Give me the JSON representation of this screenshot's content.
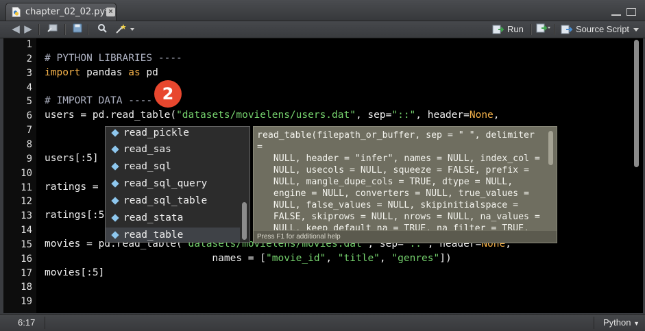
{
  "tab": {
    "label": "chapter_02_02.py*"
  },
  "toolbar": {
    "run_label": "Run",
    "source_label": "Source Script"
  },
  "badge": "2",
  "editor": {
    "line_numbers": [
      "1",
      "2",
      "3",
      "4",
      "5",
      "6",
      "7",
      "8",
      "9",
      "10",
      "11",
      "12",
      "13",
      "14",
      "15",
      "16",
      "17",
      "18",
      "19"
    ],
    "lines": [
      {
        "n": 2,
        "parts": [
          {
            "t": "# PYTHON LIBRARIES ----",
            "c": "cm"
          }
        ]
      },
      {
        "n": 3,
        "parts": [
          {
            "t": "import",
            "c": "kw"
          },
          {
            "t": " pandas ",
            "c": ""
          },
          {
            "t": "as",
            "c": "kw"
          },
          {
            "t": " pd",
            "c": ""
          }
        ]
      },
      {
        "n": 5,
        "parts": [
          {
            "t": "# IMPORT DATA ----",
            "c": "cm"
          }
        ]
      },
      {
        "n": 6,
        "parts": [
          {
            "t": "users = pd.read_table(",
            "c": ""
          },
          {
            "t": "\"datasets/movielens/users.dat\"",
            "c": "str"
          },
          {
            "t": ", sep=",
            "c": ""
          },
          {
            "t": "\"::\"",
            "c": "str"
          },
          {
            "t": ", header=",
            "c": ""
          },
          {
            "t": "None",
            "c": "kw"
          },
          {
            "t": ",",
            "c": ""
          }
        ]
      },
      {
        "n": 9,
        "parts": [
          {
            "t": "users[:5]",
            "c": ""
          }
        ]
      },
      {
        "n": 11,
        "parts": [
          {
            "t": "ratings =",
            "c": ""
          }
        ]
      },
      {
        "n": 13,
        "parts": [
          {
            "t": "ratings[:5",
            "c": ""
          }
        ]
      },
      {
        "n": 15,
        "parts": [
          {
            "t": "movies = pd.read_table(",
            "c": ""
          },
          {
            "t": "\"datasets/movielens/movies.dat\"",
            "c": "str"
          },
          {
            "t": ", sep=",
            "c": ""
          },
          {
            "t": "\"::\"",
            "c": "str"
          },
          {
            "t": ", header=",
            "c": ""
          },
          {
            "t": "None",
            "c": "kw"
          },
          {
            "t": ",",
            "c": ""
          }
        ]
      },
      {
        "n": 16,
        "parts": [
          {
            "t": "                            names = [",
            "c": ""
          },
          {
            "t": "\"movie_id\"",
            "c": "str"
          },
          {
            "t": ", ",
            "c": ""
          },
          {
            "t": "\"title\"",
            "c": "str"
          },
          {
            "t": ", ",
            "c": ""
          },
          {
            "t": "\"genres\"",
            "c": "str"
          },
          {
            "t": "])",
            "c": ""
          }
        ]
      },
      {
        "n": 17,
        "parts": [
          {
            "t": "movies[:5]",
            "c": ""
          }
        ]
      }
    ]
  },
  "completion": {
    "items": [
      "read_pickle",
      "read_sas",
      "read_sql",
      "read_sql_query",
      "read_sql_table",
      "read_stata",
      "read_table"
    ],
    "selected": "read_table"
  },
  "help": {
    "signature": "read_table(filepath_or_buffer, sep = \" \", delimiter =\n   NULL, header = \"infer\", names = NULL, index_col =\n   NULL, usecols = NULL, squeeze = FALSE, prefix =\n   NULL, mangle_dupe_cols = TRUE, dtype = NULL,\n   engine = NULL, converters = NULL, true_values =\n   NULL, false_values = NULL, skipinitialspace =\n   FALSE, skiprows = NULL, nrows = NULL, na_values =\n   NULL, keep_default_na = TRUE, na_filter = TRUE,\n   verbose = FALSE, skip_blank_lines = TRUE,",
    "footer": "Press F1 for additional help"
  },
  "status": {
    "position": "6:17",
    "language": "Python"
  }
}
